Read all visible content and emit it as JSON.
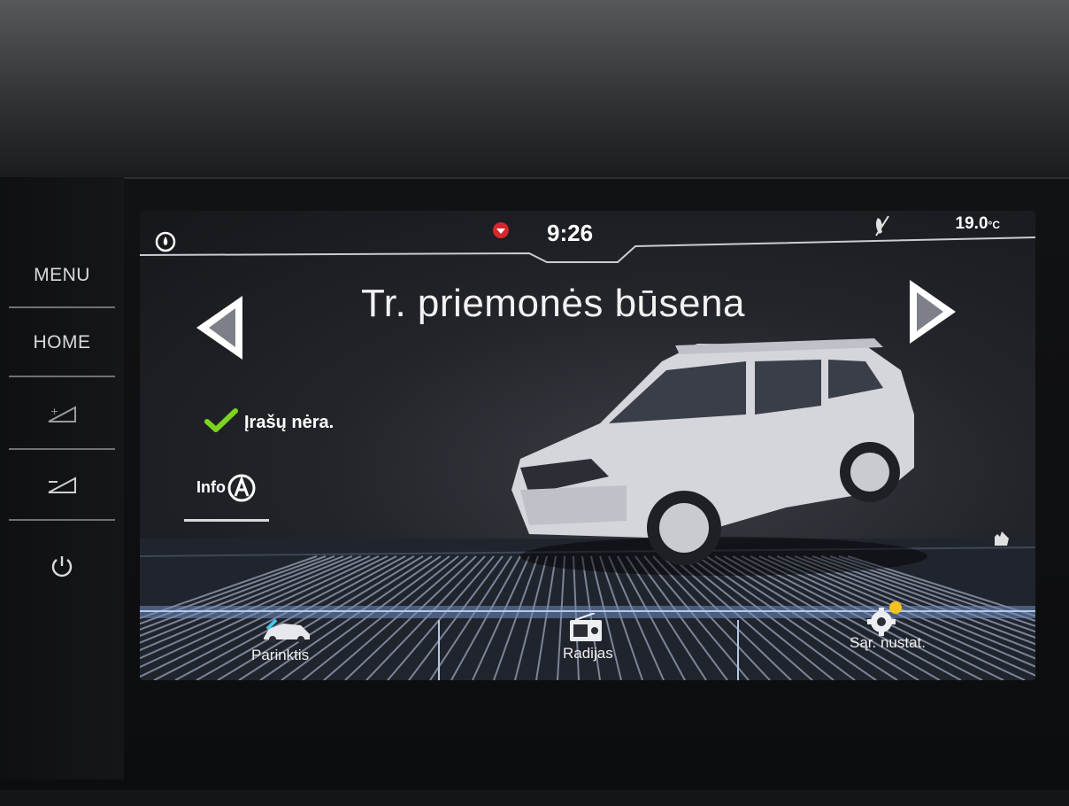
{
  "side_buttons": {
    "menu": "MENU",
    "home": "HOME"
  },
  "status_bar": {
    "time": "9:26",
    "temperature": "19.0",
    "temperature_unit": "°C"
  },
  "page": {
    "title": "Tr. priemonės būsena"
  },
  "status": {
    "message": "Įrašų nėra.",
    "info_button_label": "Info"
  },
  "bottom_bar": {
    "items": [
      {
        "label": "Parinktis",
        "icon": "car-options-icon"
      },
      {
        "label": "Radijas",
        "icon": "radio-icon"
      },
      {
        "label": "Sąr. nustat.",
        "icon": "settings-gear-icon"
      }
    ]
  },
  "colors": {
    "check": "#7ed321",
    "accent_red": "#d8262c",
    "floor_lines": "#9fb3d9"
  }
}
